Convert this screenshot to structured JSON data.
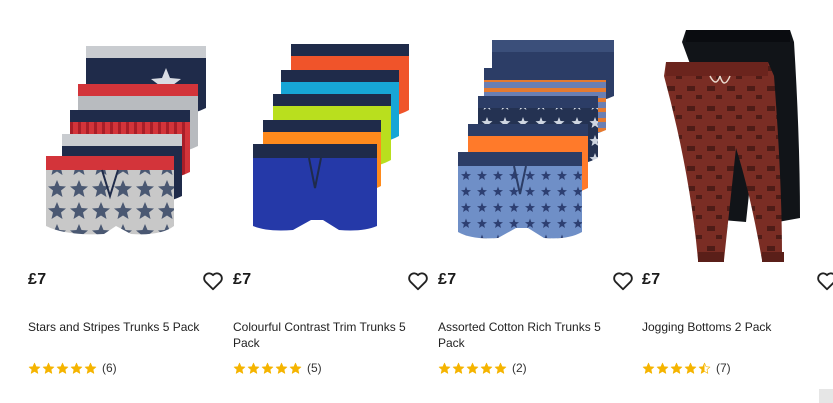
{
  "colors": {
    "star": "#f5b400",
    "heart": "#222222",
    "price": "#1a1a1a"
  },
  "products": [
    {
      "price": "£7",
      "name": "Stars and Stripes Trunks 5 Pack",
      "rating": 5,
      "review_count": "(6)",
      "wishlist_icon": "heart-outline-icon"
    },
    {
      "price": "£7",
      "name": "Colourful Contrast Trim Trunks 5 Pack",
      "rating": 5,
      "review_count": "(5)",
      "wishlist_icon": "heart-outline-icon"
    },
    {
      "price": "£7",
      "name": "Assorted Cotton Rich Trunks 5 Pack",
      "rating": 5,
      "review_count": "(2)",
      "wishlist_icon": "heart-outline-icon"
    },
    {
      "price": "£7",
      "name": "Jogging Bottoms 2 Pack",
      "rating": 4.5,
      "review_count": "(7)",
      "wishlist_icon": "heart-outline-icon"
    }
  ]
}
